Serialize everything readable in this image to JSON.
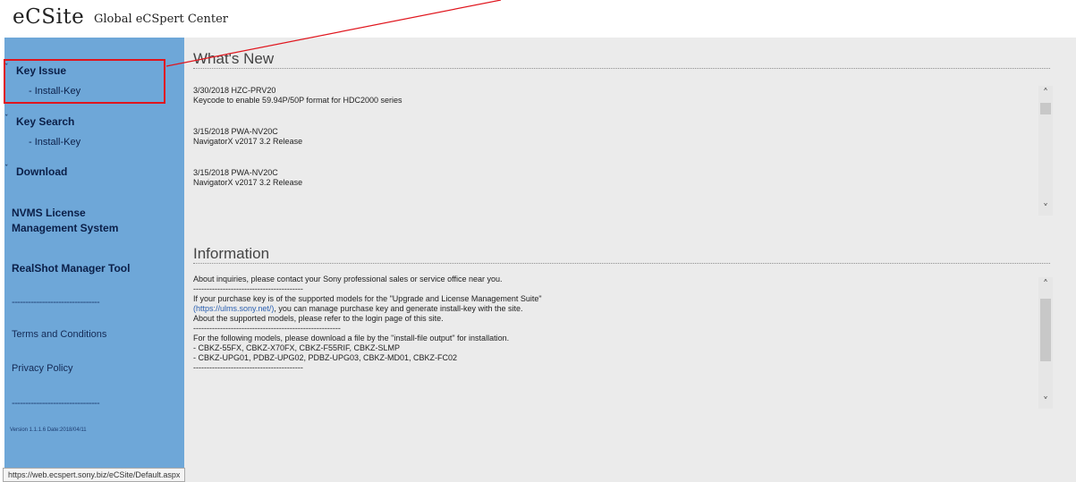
{
  "header": {
    "logo": "eCSite",
    "subtitle": "Global eCSpert Center"
  },
  "sidebar": {
    "sections": [
      {
        "label": "Key Issue",
        "sub": "- Install-Key"
      },
      {
        "label": "Key Search",
        "sub": "- Install-Key"
      },
      {
        "label": "Download"
      }
    ],
    "nvms_line1": "NVMS License",
    "nvms_line2": "Management System",
    "realshot": "RealShot Manager Tool",
    "separator": "--------------------------------",
    "terms": "Terms and Conditions",
    "privacy": "Privacy Policy",
    "version": "Version 1.1.1.6 Date:2018/04/11"
  },
  "whats_new": {
    "title": "What's New",
    "items": [
      {
        "date_model": "3/30/2018 HZC-PRV20",
        "desc": "Keycode to enable 59.94P/50P format for HDC2000 series"
      },
      {
        "date_model": "3/15/2018 PWA-NV20C",
        "desc": "NavigatorX v2017 3.2 Release"
      },
      {
        "date_model": "3/15/2018 PWA-NV20C",
        "desc": "NavigatorX v2017 3.2 Release"
      }
    ]
  },
  "information": {
    "title": "Information",
    "lines": {
      "l1": "About inquiries, please contact your Sony professional sales or service office near you.",
      "l2": "-----------------------------------------",
      "l3": "If your purchase key is of the supported models for the \"Upgrade and License Management Suite\"",
      "l4_link": "(https://ulms.sony.net/)",
      "l4_rest": ", you can manage purchase key and generate install-key with the site.",
      "l5": "About the supported models, please refer to the login page of this site.",
      "l6": "-------------------------------------------------------",
      "l7": "For the following models, please download a file by the \"install-file output\" for installation.",
      "l8": "- CBKZ-55FX, CBKZ-X70FX, CBKZ-F55RIF, CBKZ-SLMP",
      "l9": "- CBKZ-UPG01, PDBZ-UPG02, PDBZ-UPG03, CBKZ-MD01, CBKZ-FC02",
      "l10": "-----------------------------------------"
    }
  },
  "status_bar": {
    "url": "https://web.ecspert.sony.biz/eCSite/Default.aspx"
  },
  "icons": {
    "expand": "chevron-down-icon",
    "scroll_up": "chevron-up-icon",
    "scroll_down": "chevron-down-icon"
  },
  "colors": {
    "sidebar": "#6ea7d8",
    "highlight": "#e0151d",
    "content_bg": "#ebebeb"
  }
}
